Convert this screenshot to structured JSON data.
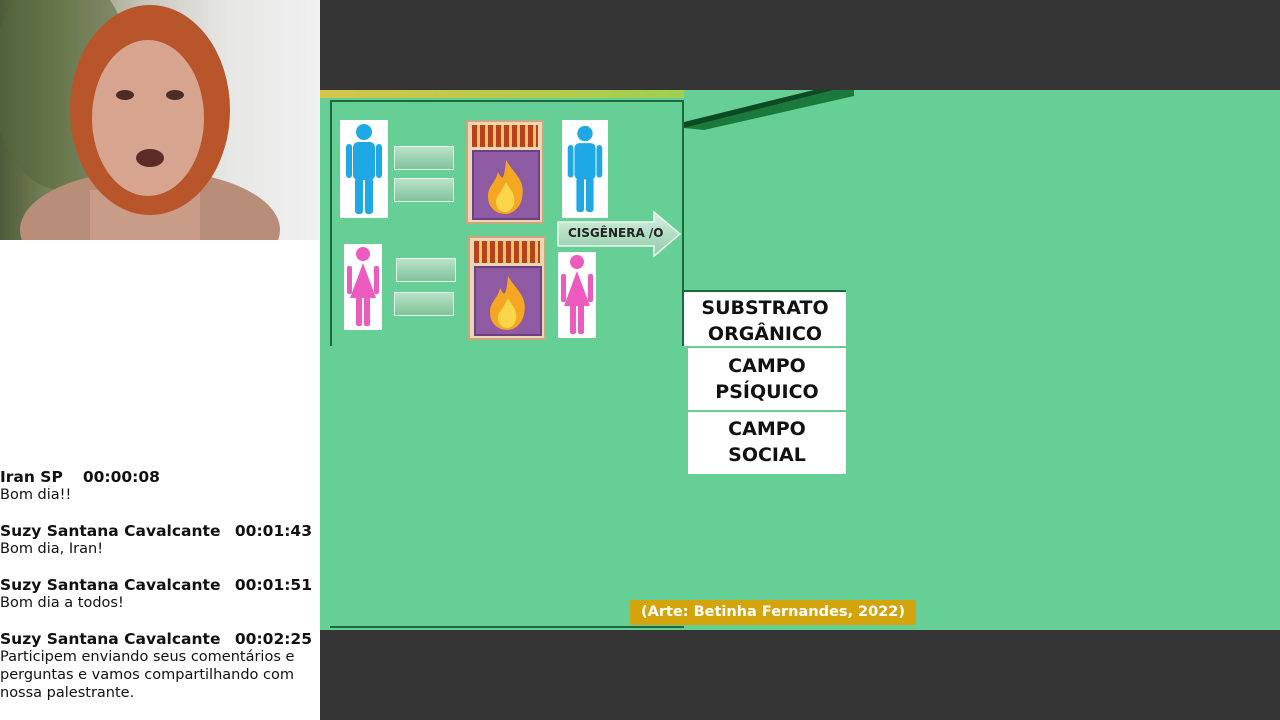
{
  "video": {
    "speaker_alt": "speaker webcam"
  },
  "chat": {
    "messages": [
      {
        "author": "Iran SP",
        "time": "00:00:08",
        "text": "Bom dia!!"
      },
      {
        "author": "Suzy Santana Cavalcante",
        "time": "00:01:43",
        "text": "Bom dia, Iran!"
      },
      {
        "author": "Suzy Santana Cavalcante",
        "time": "00:01:51",
        "text": "Bom dia a todos!"
      },
      {
        "author": "Suzy Santana Cavalcante",
        "time": "00:02:25",
        "text": "Participem enviando seus comentários e perguntas e vamos compartilhando com nossa palestrante."
      }
    ]
  },
  "slide": {
    "arrow_label": "CISGÊNERA /O",
    "concepts": [
      {
        "line1": "SUBSTRATO",
        "line2": "ORGÂNICO"
      },
      {
        "line1": "CAMPO",
        "line2": "PSÍQUICO"
      },
      {
        "line1": "CAMPO",
        "line2": "SOCIAL"
      }
    ],
    "credit": "(Arte: Betinha Fernandes, 2022)"
  },
  "colors": {
    "slide_bg": "#66cf96",
    "male_figure": "#1ea8e6",
    "female_figure": "#ec5bbd",
    "credit_bg": "#d4a40c",
    "chrome": "#353535"
  },
  "icons": [
    "male-figure-icon",
    "female-figure-icon",
    "matchbox-fire-icon",
    "arrow-right-icon"
  ]
}
